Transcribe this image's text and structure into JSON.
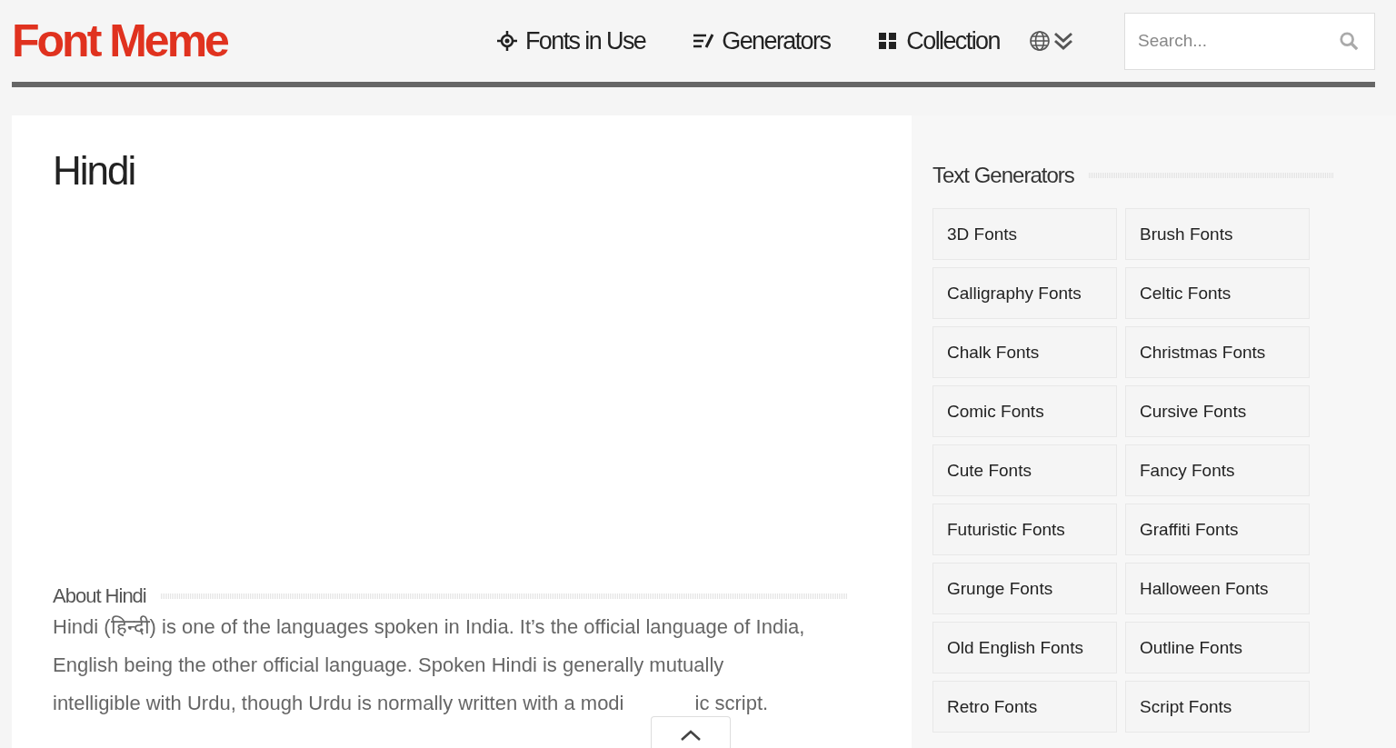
{
  "header": {
    "logo": "Font Meme",
    "nav": [
      {
        "label": "Fonts in Use"
      },
      {
        "label": "Generators"
      },
      {
        "label": "Collection"
      }
    ],
    "search": {
      "placeholder": "Search..."
    }
  },
  "article": {
    "title": "Hindi",
    "section_title": "About Hindi",
    "lines": [
      "Hindi (हिन्दी) is one of the languages spoken in India. It’s the official language of India,",
      "English being the other official language. Spoken Hindi is generally mutually"
    ],
    "last_line": {
      "before": "intelligible with Urdu, though Urdu is normally written with a modi",
      "after": "ic script."
    }
  },
  "sidebar": {
    "title": "Text Generators",
    "links": [
      "3D Fonts",
      "Brush Fonts",
      "Calligraphy Fonts",
      "Celtic Fonts",
      "Chalk Fonts",
      "Christmas Fonts",
      "Comic Fonts",
      "Cursive Fonts",
      "Cute Fonts",
      "Fancy Fonts",
      "Futuristic Fonts",
      "Graffiti Fonts",
      "Grunge Fonts",
      "Halloween Fonts",
      "Old English Fonts",
      "Outline Fonts",
      "Retro Fonts",
      "Script Fonts"
    ]
  }
}
